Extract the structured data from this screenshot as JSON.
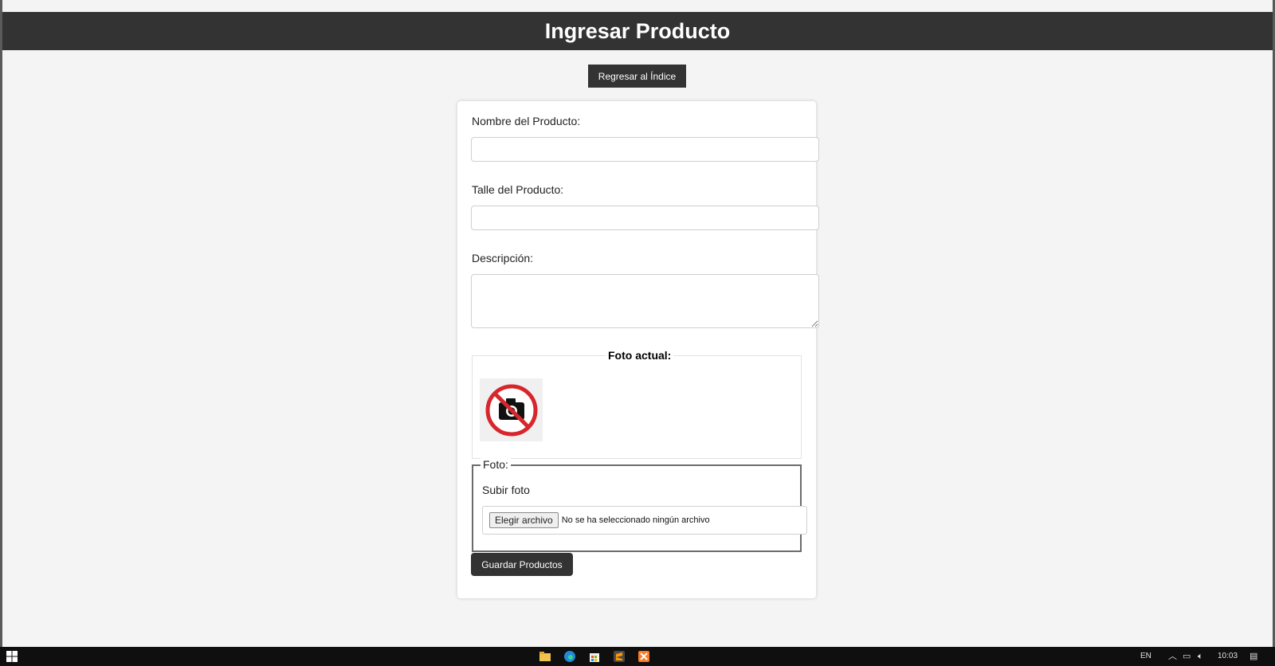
{
  "header": {
    "title": "Ingresar Producto"
  },
  "back_button": {
    "label": "Regresar al Índice"
  },
  "form": {
    "name_label": "Nombre del Producto:",
    "name_value": "",
    "size_label": "Talle del Producto:",
    "size_value": "",
    "description_label": "Descripción:",
    "description_value": "",
    "current_photo_legend": "Foto actual:",
    "current_photo_icon": "no-camera-icon",
    "photo_legend": "Foto:",
    "upload_label": "Subir foto",
    "file_button_label": "Elegir archivo",
    "file_status": "No se ha seleccionado ningún archivo",
    "save_button_label": "Guardar Productos"
  },
  "taskbar": {
    "apps": [
      "file-explorer-icon",
      "edge-icon",
      "store-icon",
      "sublime-text-icon",
      "xampp-icon"
    ],
    "language": "EN",
    "time": "10:03"
  },
  "colors": {
    "header_bg": "#333333",
    "page_bg": "#f4f4f4",
    "button_bg": "#333333",
    "no_photo_red": "#d7262c"
  }
}
